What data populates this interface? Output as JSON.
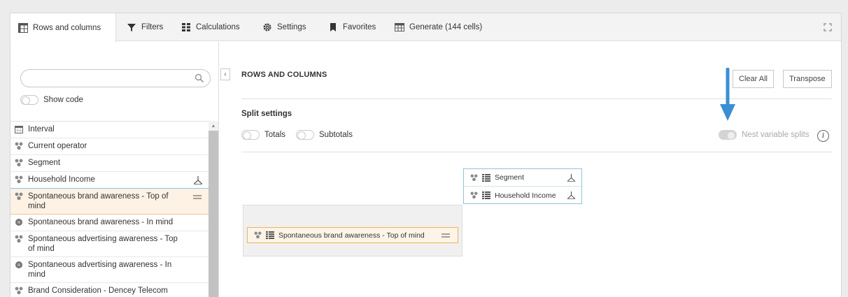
{
  "tabs": [
    {
      "label": "Rows and columns",
      "icon": "table-layout-icon",
      "active": true
    },
    {
      "label": "Filters",
      "icon": "filter-icon"
    },
    {
      "label": "Calculations",
      "icon": "calculator-icon"
    },
    {
      "label": "Settings",
      "icon": "gear-icon"
    },
    {
      "label": "Favorites",
      "icon": "bookmark-icon"
    },
    {
      "label": "Generate (144 cells)",
      "icon": "table-grid-icon"
    }
  ],
  "sidebar": {
    "search_placeholder": "",
    "show_code_label": "Show code",
    "items": [
      {
        "label": "Interval",
        "icon": "calendar-icon"
      },
      {
        "label": "Current operator",
        "icon": "variable-icon"
      },
      {
        "label": "Segment",
        "icon": "variable-icon"
      },
      {
        "label": "Household Income",
        "icon": "variable-icon",
        "state": "in-columns"
      },
      {
        "label": "Spontaneous brand awareness - Top of mind",
        "icon": "variable-icon",
        "state": "in-rows"
      },
      {
        "label": "Spontaneous brand awareness - In mind",
        "icon": "open-variable-icon"
      },
      {
        "label": "Spontaneous advertising awareness - Top of mind",
        "icon": "variable-icon"
      },
      {
        "label": "Spontaneous advertising awareness - In mind",
        "icon": "open-variable-icon"
      },
      {
        "label": "Brand Consideration - Dencey Telecom",
        "icon": "variable-icon"
      }
    ]
  },
  "main": {
    "section_title": "ROWS AND COLUMNS",
    "clear_all_label": "Clear All",
    "transpose_label": "Transpose",
    "split_settings_title": "Split settings",
    "totals_label": "Totals",
    "subtotals_label": "Subtotals",
    "nest_label": "Nest variable splits",
    "info_label": "i",
    "columns": [
      {
        "label": "Segment"
      },
      {
        "label": "Household Income"
      }
    ],
    "rows": [
      {
        "label": "Spontaneous brand awareness - Top of mind"
      }
    ]
  },
  "colors": {
    "arrow": "#3a8fd4",
    "columns_border": "#8cc4de",
    "rows_border": "#f0b45b"
  }
}
